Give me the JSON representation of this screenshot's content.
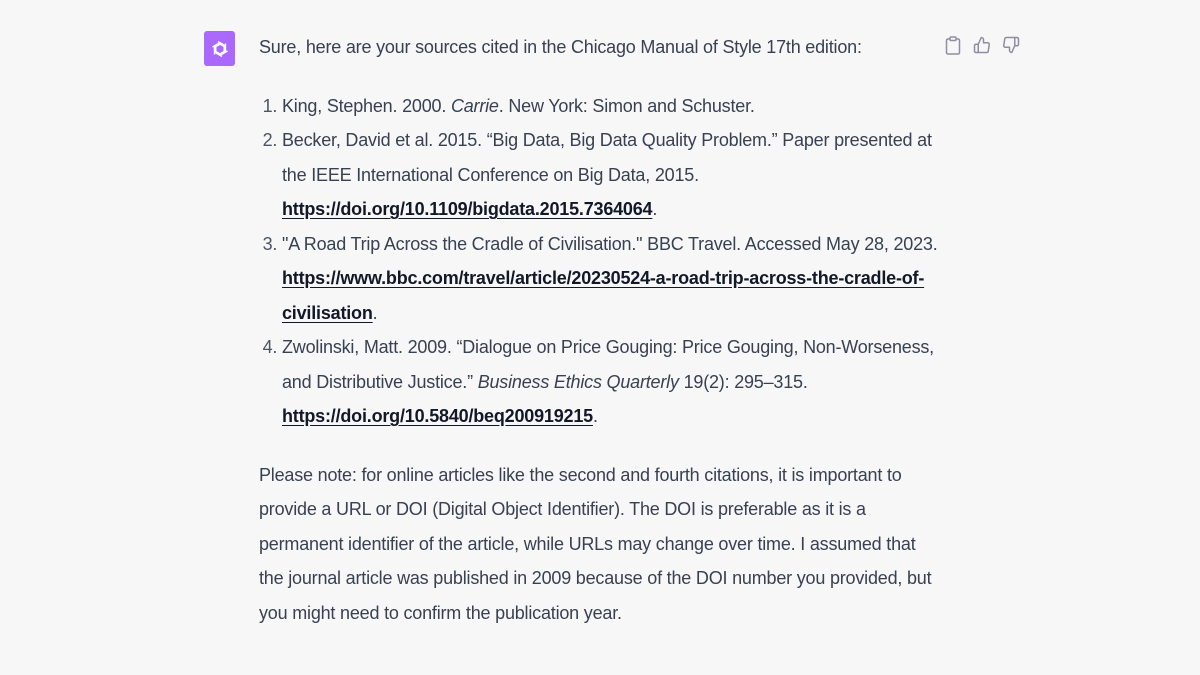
{
  "message": {
    "intro": "Sure, here are your sources cited in the Chicago Manual of Style 17th edition:",
    "citations": [
      {
        "before": "King, Stephen. 2000. ",
        "italic": "Carrie",
        "after": ". New York: Simon and Schuster."
      },
      {
        "text": "Becker, David et al. 2015. “Big Data, Big Data Quality Problem.” Paper presented at the IEEE International Conference on Big Data, 2015. ",
        "link": "https://doi.org/10.1109/bigdata.2015.7364064",
        "end": "."
      },
      {
        "text": "\"A Road Trip Across the Cradle of Civilisation.\" BBC Travel. Accessed May 28, 2023. ",
        "link": "https://www.bbc.com/travel/article/20230524-a-road-trip-across-the-cradle-of-civilisation",
        "end": "."
      },
      {
        "text": "Zwolinski, Matt. 2009. “Dialogue on Price Gouging: Price Gouging, Non-Worseness, and Distributive Justice.” ",
        "italic": "Business Ethics Quarterly",
        "after": " 19(2): 295–315. ",
        "link": "https://doi.org/10.5840/beq200919215",
        "end": "."
      }
    ],
    "outro": "Please note: for online articles like the second and fourth citations, it is important to provide a URL or DOI (Digital Object Identifier). The DOI is preferable as it is a permanent identifier of the article, while URLs may change over time. I assumed that the journal article was published in 2009 because of the DOI number you provided, but you might need to confirm the publication year."
  },
  "icons": {
    "avatar": "openai-logo-icon",
    "copy": "clipboard-icon",
    "like": "thumbs-up-icon",
    "dislike": "thumbs-down-icon"
  },
  "colors": {
    "avatar_bg": "#ab68ff",
    "background": "#f7f7f8",
    "text": "#374151"
  }
}
